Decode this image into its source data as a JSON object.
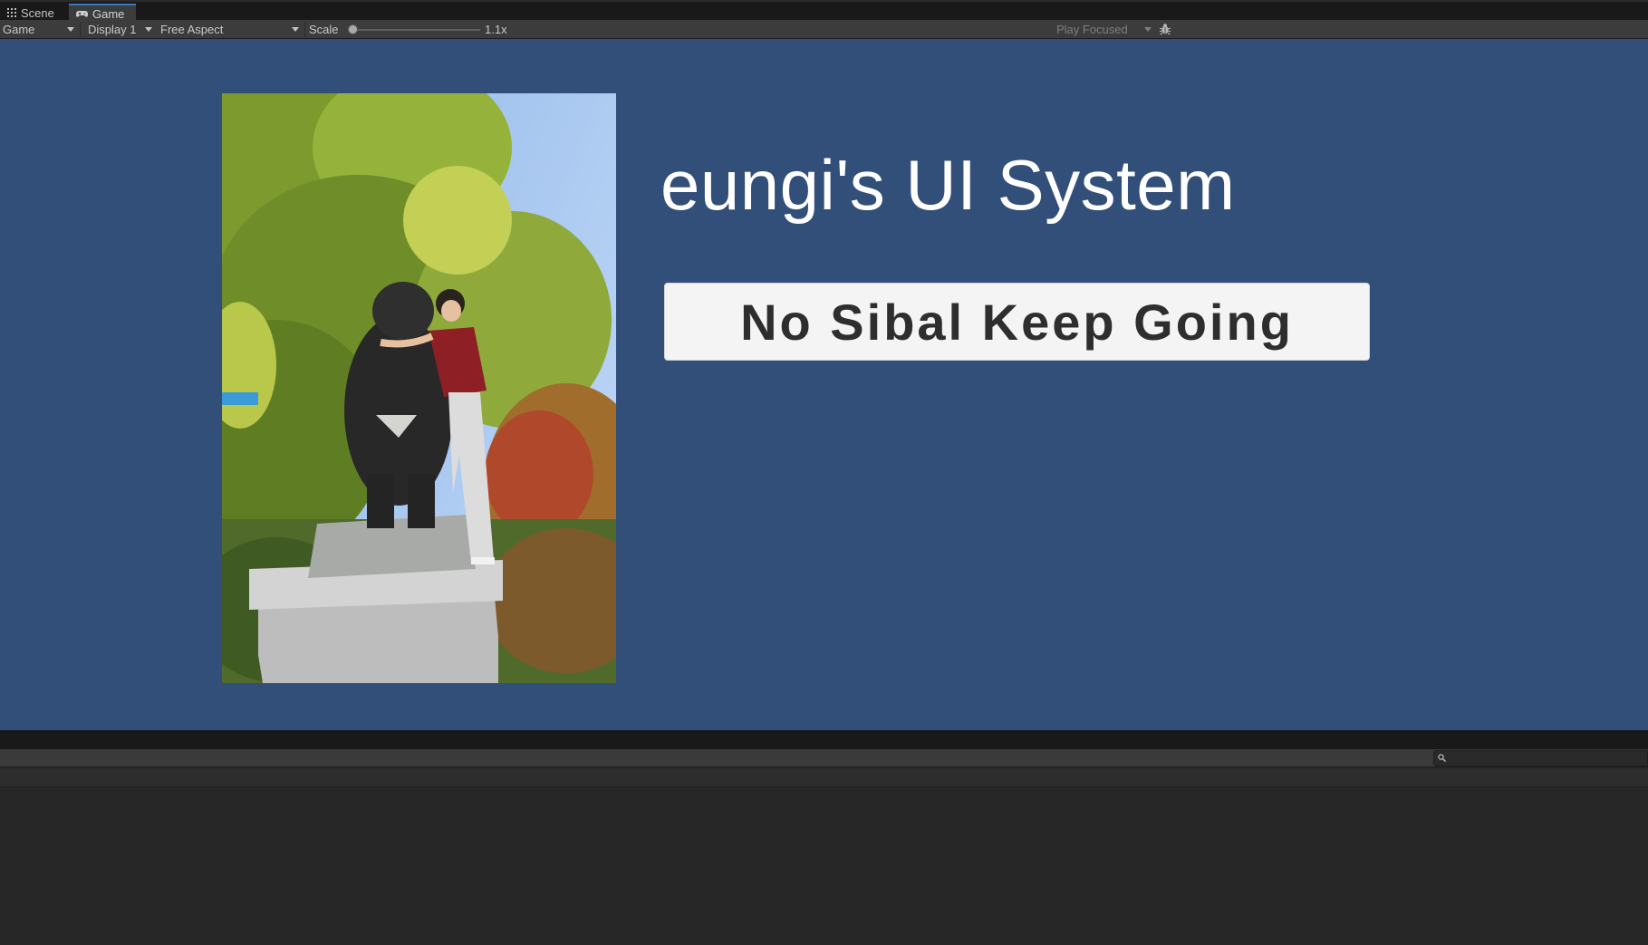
{
  "tabs": [
    {
      "label": "Scene",
      "icon": "grid-icon"
    },
    {
      "label": "Game",
      "icon": "gamepad-icon",
      "active": true
    }
  ],
  "toolbar": {
    "view_mode": "Game",
    "display": "Display 1",
    "aspect": "Free Aspect",
    "scale_label": "Scale",
    "scale_value": "1.1x",
    "scale_fraction": 0.05,
    "play_mode": "Play Focused",
    "stats_icon": "bug-icon"
  },
  "game": {
    "background_color": "#324f79",
    "photo_alt": "Person hugging a black bear statue on a stone pedestal in front of trees",
    "title": "eungi's UI System",
    "button_label": "No Sibal Keep Going"
  },
  "console": {
    "search_placeholder": "",
    "search_icon": "search-icon"
  }
}
